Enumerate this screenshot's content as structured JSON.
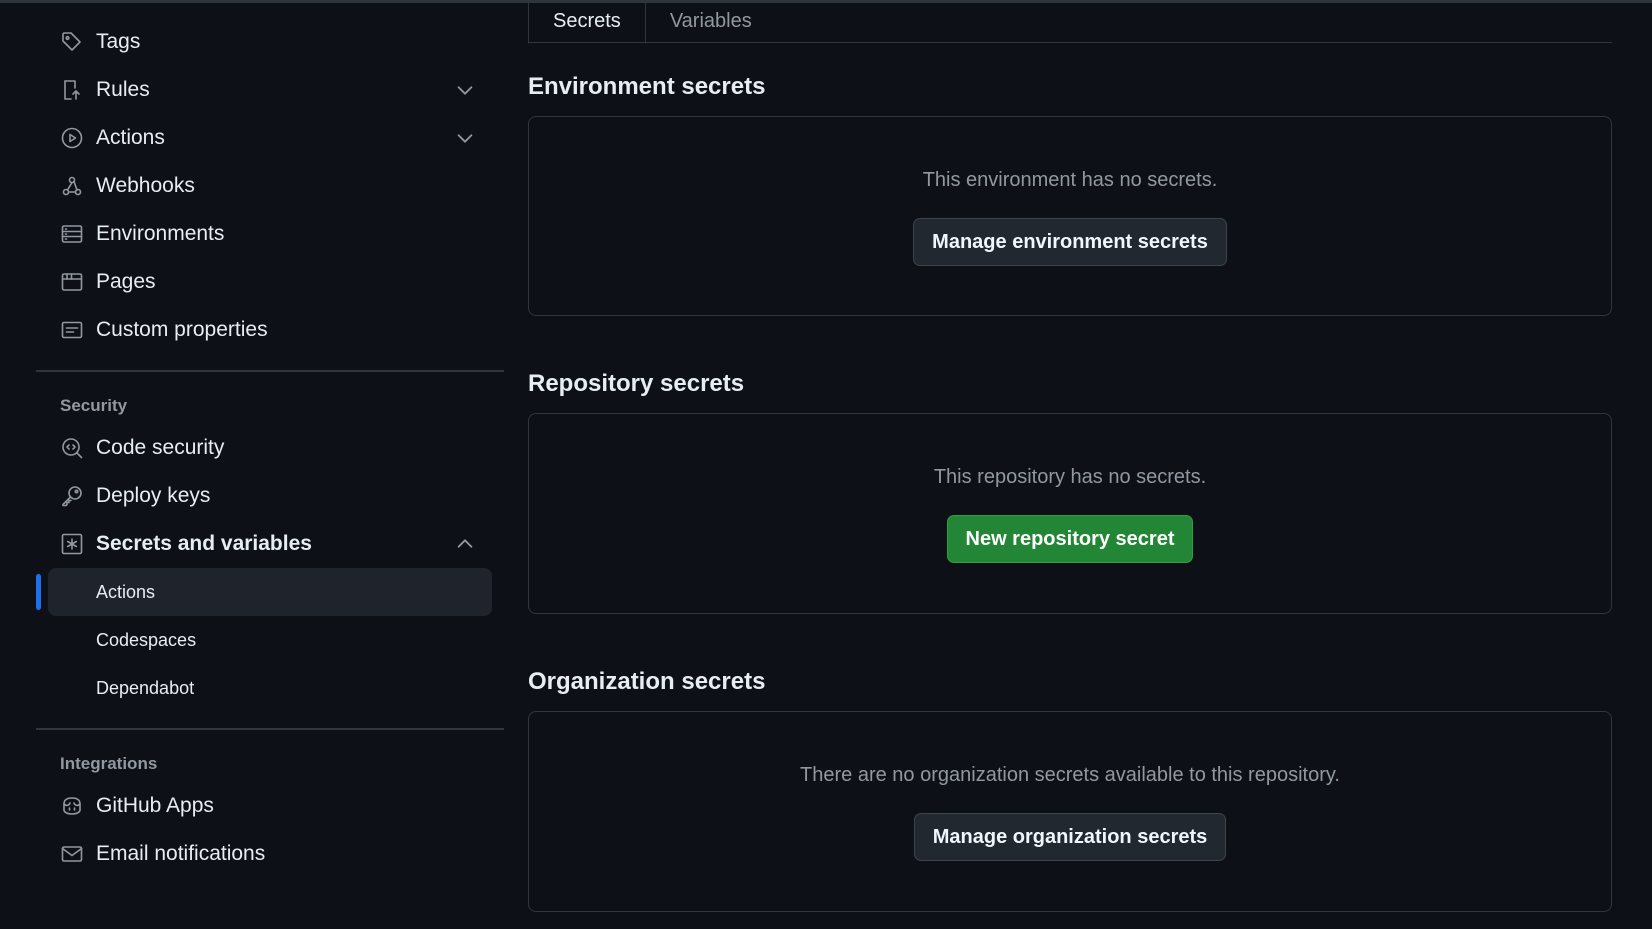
{
  "sidebar": {
    "top_items": [
      {
        "label": "Tags",
        "icon": "tag-icon"
      },
      {
        "label": "Rules",
        "icon": "rules-icon",
        "expandable": true
      },
      {
        "label": "Actions",
        "icon": "play-icon",
        "expandable": true
      },
      {
        "label": "Webhooks",
        "icon": "webhook-icon"
      },
      {
        "label": "Environments",
        "icon": "server-icon"
      },
      {
        "label": "Pages",
        "icon": "browser-icon"
      },
      {
        "label": "Custom properties",
        "icon": "note-icon"
      }
    ],
    "security_title": "Security",
    "security_items": [
      {
        "label": "Code security",
        "icon": "codescan-icon"
      },
      {
        "label": "Deploy keys",
        "icon": "key-icon"
      },
      {
        "label": "Secrets and variables",
        "icon": "asterisk-icon",
        "expanded": true
      }
    ],
    "secrets_sub_items": [
      {
        "label": "Actions",
        "active": true
      },
      {
        "label": "Codespaces"
      },
      {
        "label": "Dependabot"
      }
    ],
    "integrations_title": "Integrations",
    "integration_items": [
      {
        "label": "GitHub Apps",
        "icon": "copilot-icon"
      },
      {
        "label": "Email notifications",
        "icon": "mail-icon"
      }
    ]
  },
  "main": {
    "tabs": [
      {
        "label": "Secrets",
        "selected": true
      },
      {
        "label": "Variables"
      }
    ],
    "environment": {
      "heading": "Environment secrets",
      "message": "This environment has no secrets.",
      "button": "Manage environment secrets"
    },
    "repository": {
      "heading": "Repository secrets",
      "message": "This repository has no secrets.",
      "button": "New repository secret"
    },
    "organization": {
      "heading": "Organization secrets",
      "message": "There are no organization secrets available to this repository.",
      "button": "Manage organization secrets"
    }
  },
  "colors": {
    "background": "#0d1117",
    "border": "#30363d",
    "accent_blue": "#1f6feb",
    "primary_green": "#238636",
    "muted_text": "#9198a1"
  }
}
